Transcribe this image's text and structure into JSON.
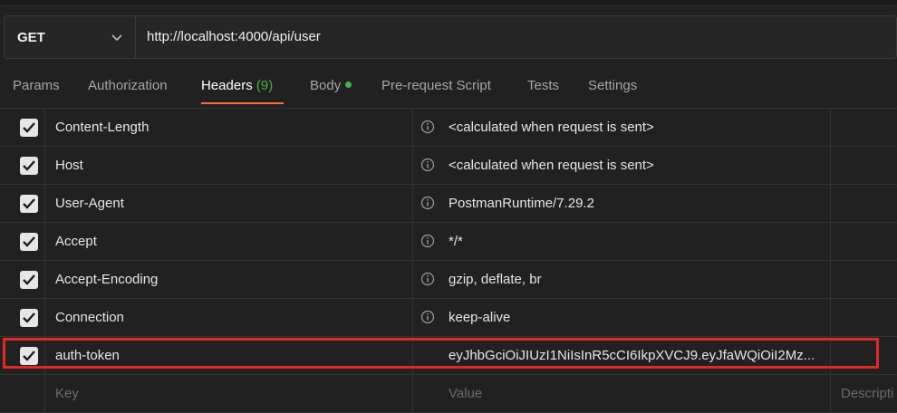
{
  "request": {
    "method": "GET",
    "url": "http://localhost:4000/api/user"
  },
  "tabs": [
    {
      "label": "Params"
    },
    {
      "label": "Authorization"
    },
    {
      "label": "Headers",
      "count": "(9)"
    },
    {
      "label": "Body"
    },
    {
      "label": "Pre-request Script"
    },
    {
      "label": "Tests"
    },
    {
      "label": "Settings"
    }
  ],
  "headers": [
    {
      "key": "Content-Length",
      "value": "<calculated when request is sent>",
      "checked": true
    },
    {
      "key": "Host",
      "value": "<calculated when request is sent>",
      "checked": true
    },
    {
      "key": "User-Agent",
      "value": "PostmanRuntime/7.29.2",
      "checked": true
    },
    {
      "key": "Accept",
      "value": "*/*",
      "checked": true
    },
    {
      "key": "Accept-Encoding",
      "value": "gzip, deflate, br",
      "checked": true
    },
    {
      "key": "Connection",
      "value": "keep-alive",
      "checked": true
    },
    {
      "key": "auth-token",
      "value": "eyJhbGciOiJIUzI1NiIsInR5cCI6IkpXVCJ9.eyJfaWQiOiI2Mz...",
      "checked": true
    }
  ],
  "new_row": {
    "key_placeholder": "Key",
    "value_placeholder": "Value",
    "description_placeholder": "Descripti"
  },
  "colors": {
    "accent": "#ff6c37",
    "count_green": "#4caf50",
    "highlight": "#e32626"
  }
}
